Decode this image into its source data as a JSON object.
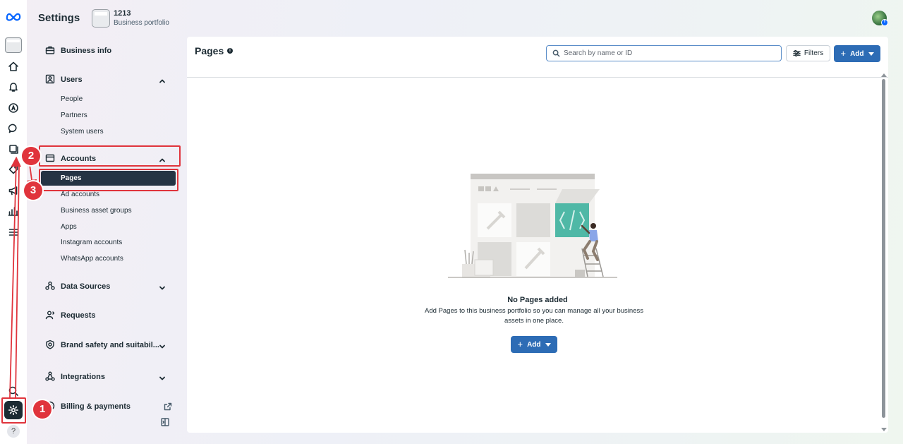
{
  "header": {
    "title": "Settings",
    "portfolio_name": "1213",
    "portfolio_type": "Business portfolio"
  },
  "rail": {
    "icons": [
      "meta-logo-icon",
      "portfolio-icon",
      "home-icon",
      "notifications-icon",
      "ads-icon",
      "messages-icon",
      "content-icon",
      "tag-icon",
      "megaphone-icon",
      "insights-icon",
      "menu-icon",
      "search-icon",
      "gear-icon",
      "help-icon"
    ],
    "help_label": "?"
  },
  "nav": {
    "business_info": "Business info",
    "users": "Users",
    "users_items": [
      "People",
      "Partners",
      "System users"
    ],
    "accounts": "Accounts",
    "accounts_active": "Pages",
    "accounts_items": [
      "Ad accounts",
      "Business asset groups",
      "Apps",
      "Instagram accounts",
      "WhatsApp accounts"
    ],
    "data_sources": "Data Sources",
    "requests": "Requests",
    "brand_safety": "Brand safety and suitabil...",
    "integrations": "Integrations",
    "billing": "Billing & payments"
  },
  "main": {
    "title": "Pages",
    "info_icon": "i",
    "search_placeholder": "Search by name or ID",
    "filters_label": "Filters",
    "add_label": "Add",
    "empty_title": "No Pages added",
    "empty_desc": "Add Pages to this business portfolio so you can manage all your business assets in one place.",
    "empty_add_label": "Add"
  },
  "annotations": {
    "badge_1": "1",
    "badge_2": "2",
    "badge_3": "3",
    "color": "#e0343c"
  },
  "colors": {
    "accent": "#2d6cb5",
    "active_nav": "#253444",
    "meta_blue": "#0866ff"
  }
}
